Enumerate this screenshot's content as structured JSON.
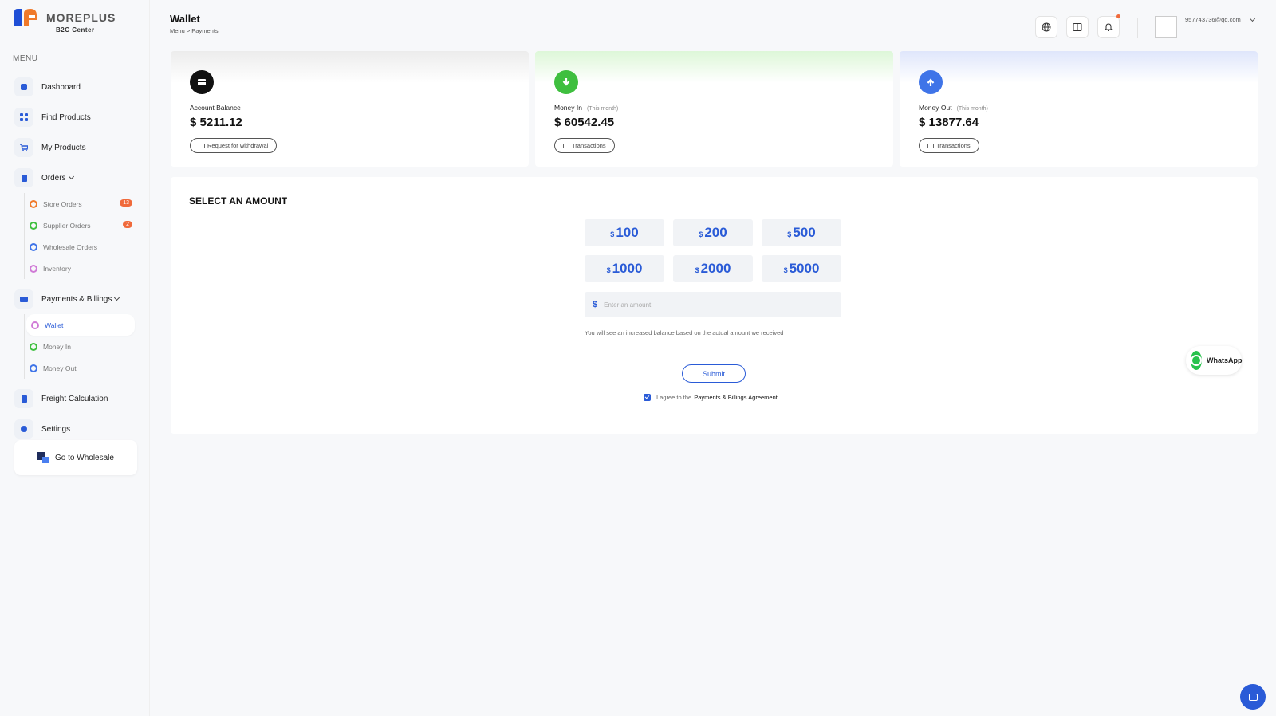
{
  "brand": {
    "name": "MOREPLUS",
    "subtitle": "B2C Center"
  },
  "sidebar": {
    "menu_label": "MENU",
    "items": [
      {
        "label": "Dashboard"
      },
      {
        "label": "Find Products"
      },
      {
        "label": "My Products"
      },
      {
        "label": "Orders",
        "sub": [
          {
            "label": "Store Orders",
            "badge": "13"
          },
          {
            "label": "Supplier Orders",
            "badge": "2"
          },
          {
            "label": "Wholesale Orders"
          },
          {
            "label": "Inventory"
          }
        ]
      },
      {
        "label": "Payments & Billings",
        "sub": [
          {
            "label": "Wallet",
            "active": true
          },
          {
            "label": "Money In"
          },
          {
            "label": "Money Out"
          }
        ]
      },
      {
        "label": "Freight Calculation"
      },
      {
        "label": "Settings"
      }
    ],
    "goto_label": "Go to Wholesale"
  },
  "header": {
    "title": "Wallet",
    "breadcrumb": "Menu  >  Payments",
    "email": "957743736@qq.com"
  },
  "cards": [
    {
      "label": "Account Balance",
      "period": "",
      "value": "$ 5211.12",
      "button": "Request for withdrawal",
      "color": "#111111"
    },
    {
      "label": "Money In",
      "period": "(This month)",
      "value": "$ 60542.45",
      "button": "Transactions",
      "color": "#3fbf3f"
    },
    {
      "label": "Money Out",
      "period": "(This month)",
      "value": "$ 13877.64",
      "button": "Transactions",
      "color": "#3f74e8"
    }
  ],
  "amount_panel": {
    "title": "SELECT AN AMOUNT",
    "currency": "$",
    "amounts": [
      "100",
      "200",
      "500",
      "1000",
      "2000",
      "5000"
    ],
    "input_placeholder": "Enter an amount",
    "note": "You will see an increased balance based on the actual amount we received",
    "submit_label": "Submit",
    "agree_text": "I agree to the",
    "agree_link": "Payments & Billings Agreement"
  },
  "floating": {
    "whatsapp_label": "WhatsApp"
  },
  "colors": {
    "accent": "#2a5bd7",
    "badge": "#f06a3b",
    "money_in": "#3fbf3f",
    "money_out": "#3f74e8"
  },
  "icons": {
    "dashboard": "dashboard-icon",
    "find_products": "grid-icon",
    "my_products": "cart-icon",
    "orders": "document-icon",
    "payments": "card-icon",
    "freight": "document-icon",
    "settings": "gear-icon",
    "globe": "globe-icon",
    "book": "book-icon",
    "bell": "bell-icon",
    "chat": "chat-icon"
  }
}
